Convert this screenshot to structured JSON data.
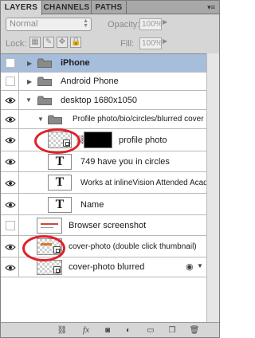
{
  "tabs": [
    {
      "label": "LAYERS",
      "active": true
    },
    {
      "label": "CHANNELS",
      "active": false
    },
    {
      "label": "PATHS",
      "active": false
    }
  ],
  "options": {
    "blend_mode": "Normal",
    "opacity_label": "Opacity:",
    "opacity_value": "100%",
    "lock_label": "Lock:",
    "fill_label": "Fill:",
    "fill_value": "100%"
  },
  "layers": [
    {
      "name": "iPhone",
      "kind": "group",
      "visible": false,
      "expanded": false,
      "selected": true
    },
    {
      "name": "Android Phone",
      "kind": "group",
      "visible": false,
      "expanded": false
    },
    {
      "name": "desktop 1680x1050",
      "kind": "group",
      "visible": true,
      "expanded": true
    },
    {
      "name": "Profile photo/bio/circles/blurred cover",
      "kind": "group",
      "visible": true,
      "expanded": true
    },
    {
      "name": "profile photo",
      "kind": "smart-object",
      "visible": true,
      "linked": true,
      "has_mask": true
    },
    {
      "name": "749 have you in circles",
      "kind": "text",
      "visible": true,
      "thumb_glyph": "T"
    },
    {
      "name": "Works at inlineVision Attended Acade...",
      "kind": "text",
      "visible": true,
      "thumb_glyph": "T"
    },
    {
      "name": "Name",
      "kind": "text",
      "visible": true,
      "thumb_glyph": "T"
    },
    {
      "name": "Browser screenshot",
      "kind": "pixel",
      "visible": false
    },
    {
      "name": "cover-photo (double click thumbnail)",
      "kind": "smart-object",
      "visible": true
    },
    {
      "name": "cover-photo blurred",
      "kind": "smart-object",
      "visible": true,
      "has_effects": true
    }
  ],
  "colors": {
    "selection": "#a6bddc",
    "annotation_circle": "#e0202a"
  },
  "bottom_toolbar": [
    "link-icon",
    "fx-icon",
    "mask-icon",
    "adjustment-icon",
    "new-group-icon",
    "new-layer-icon",
    "trash-icon"
  ]
}
